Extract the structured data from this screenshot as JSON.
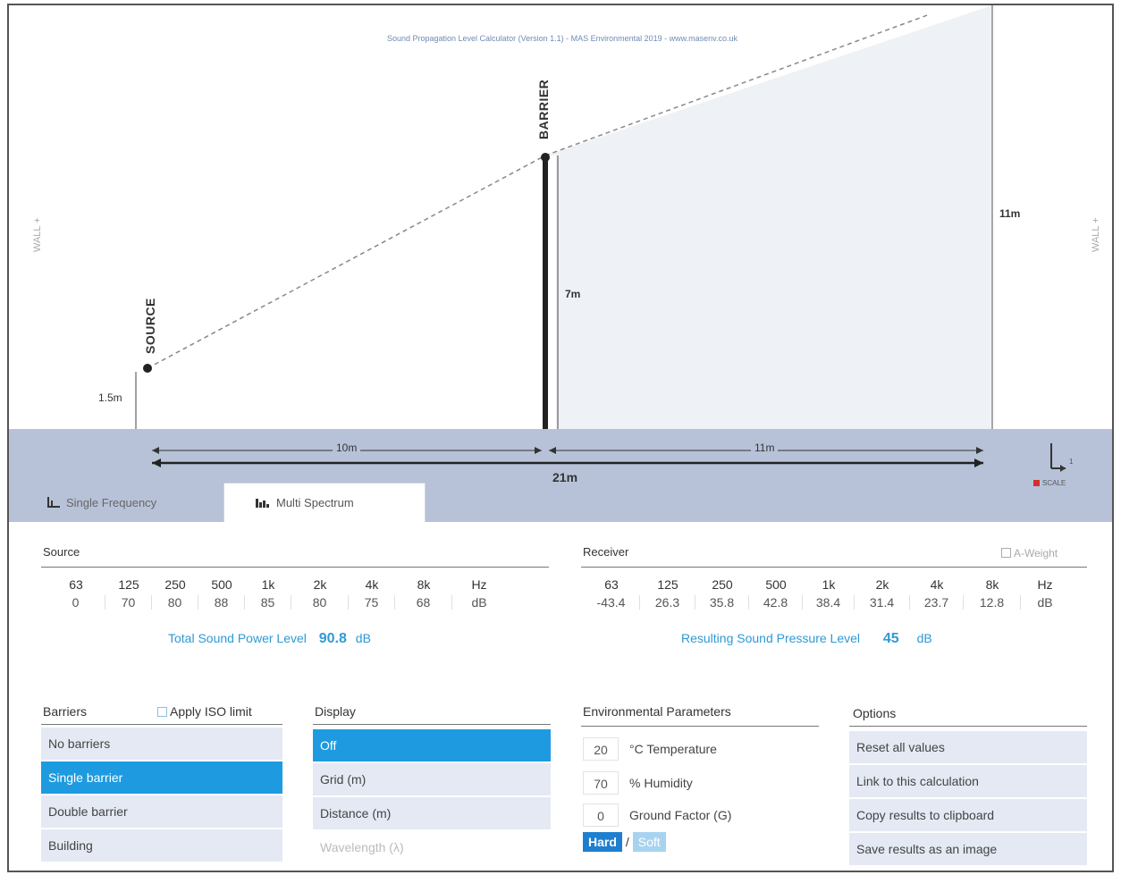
{
  "credit": "Sound Propagation Level Calculator (Version 1.1) - MAS Environmental 2019 - www.masenv.co.uk",
  "scene": {
    "wall_left": "WALL +",
    "wall_right": "WALL +",
    "source_label": "SOURCE",
    "barrier_label": "BARRIER",
    "source_height": "1.5m",
    "barrier_height": "7m",
    "receiver_height": "11m",
    "dist_source_barrier": "10m",
    "dist_barrier_receiver": "11m",
    "dist_total": "21m",
    "scale_label": "SCALE",
    "scale_unit": "1"
  },
  "tabs": [
    {
      "label": "Single Frequency"
    },
    {
      "label": "Multi Spectrum"
    }
  ],
  "source": {
    "title": "Source",
    "freqs": [
      "63",
      "125",
      "250",
      "500",
      "1k",
      "2k",
      "4k",
      "8k",
      "Hz"
    ],
    "values": [
      "0",
      "70",
      "80",
      "88",
      "85",
      "80",
      "75",
      "68",
      "dB"
    ],
    "total_label": "Total Sound Power Level",
    "total_value": "90.8",
    "total_unit": "dB"
  },
  "receiver": {
    "title": "Receiver",
    "a_weight": "A-Weight",
    "freqs": [
      "63",
      "125",
      "250",
      "500",
      "1k",
      "2k",
      "4k",
      "8k",
      "Hz"
    ],
    "values": [
      "-43.4",
      "26.3",
      "35.8",
      "42.8",
      "38.4",
      "31.4",
      "23.7",
      "12.8",
      "dB"
    ],
    "total_label": "Resulting Sound Pressure Level",
    "total_value": "45",
    "total_unit": "dB"
  },
  "barriers": {
    "title": "Barriers",
    "iso_label": "Apply ISO limit",
    "items": [
      "No barriers",
      "Single barrier",
      "Double barrier",
      "Building"
    ]
  },
  "display": {
    "title": "Display",
    "items": [
      "Off",
      "Grid (m)",
      "Distance (m)",
      "Wavelength (λ)"
    ]
  },
  "environment": {
    "title": "Environmental Parameters",
    "temperature_value": "20",
    "temperature_label": "°C Temperature",
    "humidity_value": "70",
    "humidity_label": "% Humidity",
    "ground_value": "0",
    "ground_label": "Ground Factor (G)",
    "hard": "Hard",
    "sep": "/",
    "soft": "Soft"
  },
  "options": {
    "title": "Options",
    "items": [
      "Reset all values",
      "Link to this calculation",
      "Copy results to clipboard",
      "Save results as an image"
    ]
  }
}
